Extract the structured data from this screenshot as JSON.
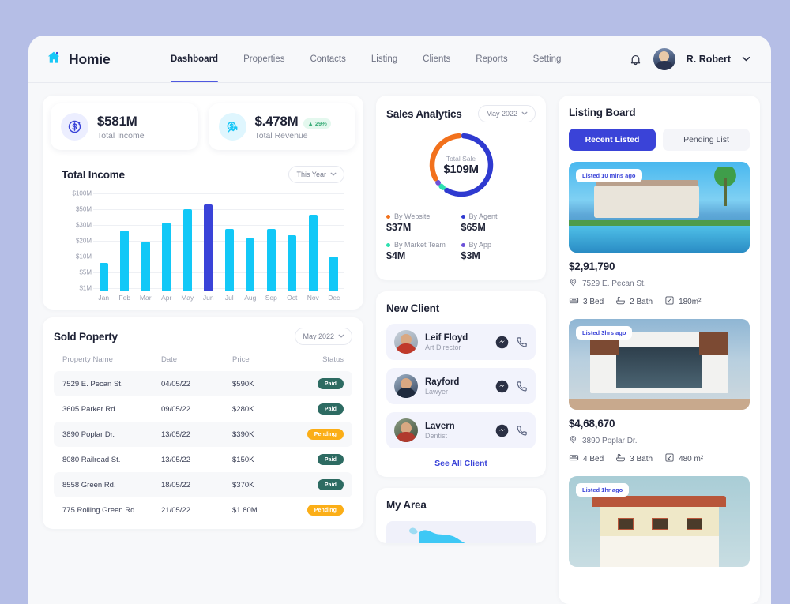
{
  "brand": {
    "name": "Homie",
    "icon": "home-icon"
  },
  "nav": {
    "items": [
      {
        "label": "Dashboard",
        "active": true
      },
      {
        "label": "Properties",
        "active": false
      },
      {
        "label": "Contacts",
        "active": false
      },
      {
        "label": "Listing",
        "active": false
      },
      {
        "label": "Clients",
        "active": false
      },
      {
        "label": "Reports",
        "active": false
      },
      {
        "label": "Setting",
        "active": false
      }
    ],
    "bell_icon": "bell-icon",
    "user_name": "R. Robert",
    "caret": "⌄"
  },
  "stats": [
    {
      "value": "$581M",
      "label": "Total Income",
      "icon": "income-circle-icon",
      "delta": null
    },
    {
      "value": "$.478M",
      "label": "Total Revenue",
      "icon": "revenue-trend-icon",
      "delta": "29%"
    }
  ],
  "income": {
    "title": "Total Income",
    "range_label": "This Year"
  },
  "sold": {
    "title": "Sold Poperty",
    "range_label": "May 2022",
    "columns": [
      "Property Name",
      "Date",
      "Price",
      "Status"
    ],
    "rows": [
      {
        "name": "7529 E. Pecan St.",
        "date": "04/05/22",
        "price": "$590K",
        "status": "Paid"
      },
      {
        "name": "3605 Parker Rd.",
        "date": "09/05/22",
        "price": "$280K",
        "status": "Paid"
      },
      {
        "name": "3890 Poplar Dr.",
        "date": "13/05/22",
        "price": "$390K",
        "status": "Pending"
      },
      {
        "name": "8080 Railroad St.",
        "date": "13/05/22",
        "price": "$150K",
        "status": "Paid"
      },
      {
        "name": "8558 Green Rd.",
        "date": "18/05/22",
        "price": "$370K",
        "status": "Paid"
      },
      {
        "name": "775 Rolling Green Rd.",
        "date": "21/05/22",
        "price": "$1.80M",
        "status": "Pending"
      }
    ]
  },
  "sales": {
    "title": "Sales Analytics",
    "range_label": "May 2022",
    "center_label": "Total Sale",
    "center_value": "$109M",
    "legend": [
      {
        "name": "By Website",
        "value": "$37M",
        "color": "#f2711c"
      },
      {
        "name": "By Agent",
        "value": "$65M",
        "color": "#2f3ad0"
      },
      {
        "name": "By Market Team",
        "value": "$4M",
        "color": "#2ee0b0"
      },
      {
        "name": "By App",
        "value": "$3M",
        "color": "#6c52d9"
      }
    ]
  },
  "clients": {
    "title": "New Client",
    "items": [
      {
        "name": "Leif Floyd",
        "role": "Art Director"
      },
      {
        "name": "Rayford",
        "role": "Lawyer"
      },
      {
        "name": "Lavern",
        "role": "Dentist"
      }
    ],
    "see_all": "See All Client",
    "message_icon": "messenger-icon",
    "call_icon": "phone-icon"
  },
  "area": {
    "title": "My Area"
  },
  "listing": {
    "title": "Listing Board",
    "tabs": [
      {
        "label": "Recent Listed",
        "active": true
      },
      {
        "label": "Pending List",
        "active": false
      }
    ],
    "items": [
      {
        "tag": "Listed 10 mins ago",
        "price": "$2,91,790",
        "address": "7529 E. Pecan St.",
        "beds": "3 Bed",
        "baths": "2 Bath",
        "area": "180m²"
      },
      {
        "tag": "Listed 3hrs ago",
        "price": "$4,68,670",
        "address": "3890 Poplar Dr.",
        "beds": "4 Bed",
        "baths": "3 Bath",
        "area": "480 m²"
      },
      {
        "tag": "Listed 1hr ago",
        "price": "",
        "address": "",
        "beds": "",
        "baths": "",
        "area": ""
      }
    ]
  },
  "colors": {
    "page_bg": "#b5bee6",
    "app_bg": "#f7f8fa",
    "accent_indigo": "#3a43d8",
    "accent_cyan": "#12c8f7",
    "paid": "#2d6b62",
    "pending": "#fbae17",
    "positive": "#3aac78"
  },
  "chart_data": {
    "type": "bar",
    "title": "Total Income",
    "categories": [
      "Jan",
      "Feb",
      "Mar",
      "Apr",
      "May",
      "Jun",
      "Jul",
      "Aug",
      "Sep",
      "Oct",
      "Nov",
      "Dec"
    ],
    "values": [
      7,
      24,
      17,
      29,
      45,
      55,
      25,
      19,
      25,
      21,
      38,
      9
    ],
    "highlight_index": 5,
    "ytick_labels": [
      "$100M",
      "$50M",
      "$30M",
      "$20M",
      "$10M",
      "$5M",
      "$1M"
    ],
    "xlabel": "",
    "ylabel": "",
    "grid": true,
    "legend": "none",
    "bar_color": "#12c8f7",
    "highlight_color": "#3a43d8"
  },
  "donut_data": {
    "type": "pie",
    "title": "Sales Analytics",
    "center_label": "Total Sale",
    "center_value": "$109M",
    "labels": [
      "By Agent",
      "By Market Team",
      "By App",
      "By Website"
    ],
    "values": [
      65,
      4,
      3,
      37
    ],
    "colors": [
      "#2f3ad0",
      "#2ee0b0",
      "#6c52d9",
      "#f2711c"
    ],
    "unit": "M",
    "legend": "bottom"
  }
}
